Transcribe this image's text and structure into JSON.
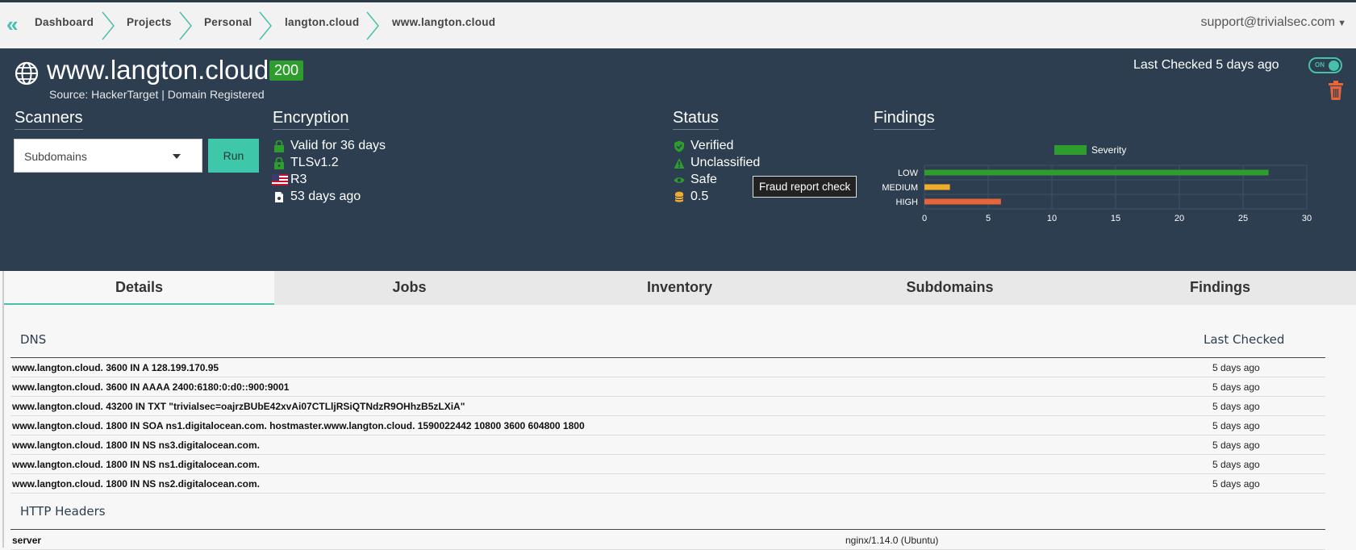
{
  "breadcrumbs": [
    "Dashboard",
    "Projects",
    "Personal",
    "langton.cloud",
    "www.langton.cloud"
  ],
  "user": {
    "email": "support@trivialsec.com"
  },
  "header": {
    "title": "www.langton.cloud",
    "status_code": "200",
    "source": "Source: HackerTarget | Domain Registered",
    "last_checked": "Last Checked 5 days ago",
    "toggle_label": "ON"
  },
  "scanners": {
    "heading": "Scanners",
    "selected": "Subdomains",
    "run_label": "Run"
  },
  "encryption": {
    "heading": "Encryption",
    "items": [
      {
        "icon": "lock-icon",
        "text": "Valid for 36 days"
      },
      {
        "icon": "unlock-icon",
        "text": "TLSv1.2"
      },
      {
        "icon": "us-flag-icon",
        "text": "R3"
      },
      {
        "icon": "document-icon",
        "text": "53 days ago"
      }
    ]
  },
  "status": {
    "heading": "Status",
    "items": [
      {
        "icon": "shield-check-icon",
        "text": "Verified"
      },
      {
        "icon": "warning-icon",
        "text": "Unclassified"
      },
      {
        "icon": "eye-icon",
        "text": "Safe"
      },
      {
        "icon": "database-icon",
        "text": "0.5"
      }
    ],
    "tooltip": "Fraud report check"
  },
  "findings": {
    "heading": "Findings"
  },
  "chart_data": {
    "type": "bar",
    "orientation": "horizontal",
    "categories": [
      "LOW",
      "MEDIUM",
      "HIGH"
    ],
    "series": [
      {
        "name": "Severity",
        "values": [
          27,
          2,
          6
        ]
      }
    ],
    "bar_colors": [
      "#2e9d2e",
      "#f0ad2c",
      "#e8643a"
    ],
    "legend_color": "#2e9d2e",
    "xticks": [
      "0",
      "5",
      "10",
      "15",
      "20",
      "25",
      "30"
    ],
    "xlim": [
      0,
      30
    ],
    "grid": true,
    "legend": "top"
  },
  "tabs": [
    "Details",
    "Jobs",
    "Inventory",
    "Subdomains",
    "Findings"
  ],
  "dns": {
    "heading": "DNS",
    "last_checked_header": "Last Checked",
    "records": [
      {
        "record": "www.langton.cloud. 3600 IN A 128.199.170.95",
        "when": "5 days ago"
      },
      {
        "record": "www.langton.cloud. 3600 IN AAAA 2400:6180:0:d0::900:9001",
        "when": "5 days ago"
      },
      {
        "record": "www.langton.cloud. 43200 IN TXT \"trivialsec=oajrzBUbE42xvAi07CTLljRSiQTNdzR9OHhzB5zLXiA\"",
        "when": "5 days ago"
      },
      {
        "record": "www.langton.cloud. 1800 IN SOA ns1.digitalocean.com. hostmaster.www.langton.cloud. 1590022442 10800 3600 604800 1800",
        "when": "5 days ago"
      },
      {
        "record": "www.langton.cloud. 1800 IN NS ns3.digitalocean.com.",
        "when": "5 days ago"
      },
      {
        "record": "www.langton.cloud. 1800 IN NS ns1.digitalocean.com.",
        "when": "5 days ago"
      },
      {
        "record": "www.langton.cloud. 1800 IN NS ns2.digitalocean.com.",
        "when": "5 days ago"
      }
    ]
  },
  "http_headers": {
    "heading": "HTTP Headers",
    "rows": [
      {
        "name": "server",
        "value": "nginx/1.14.0 (Ubuntu)"
      }
    ]
  },
  "colors": {
    "accent": "#46c0a8",
    "hero_bg": "#2c3e50",
    "ok": "#2e9d2e",
    "danger": "#e8643a"
  }
}
